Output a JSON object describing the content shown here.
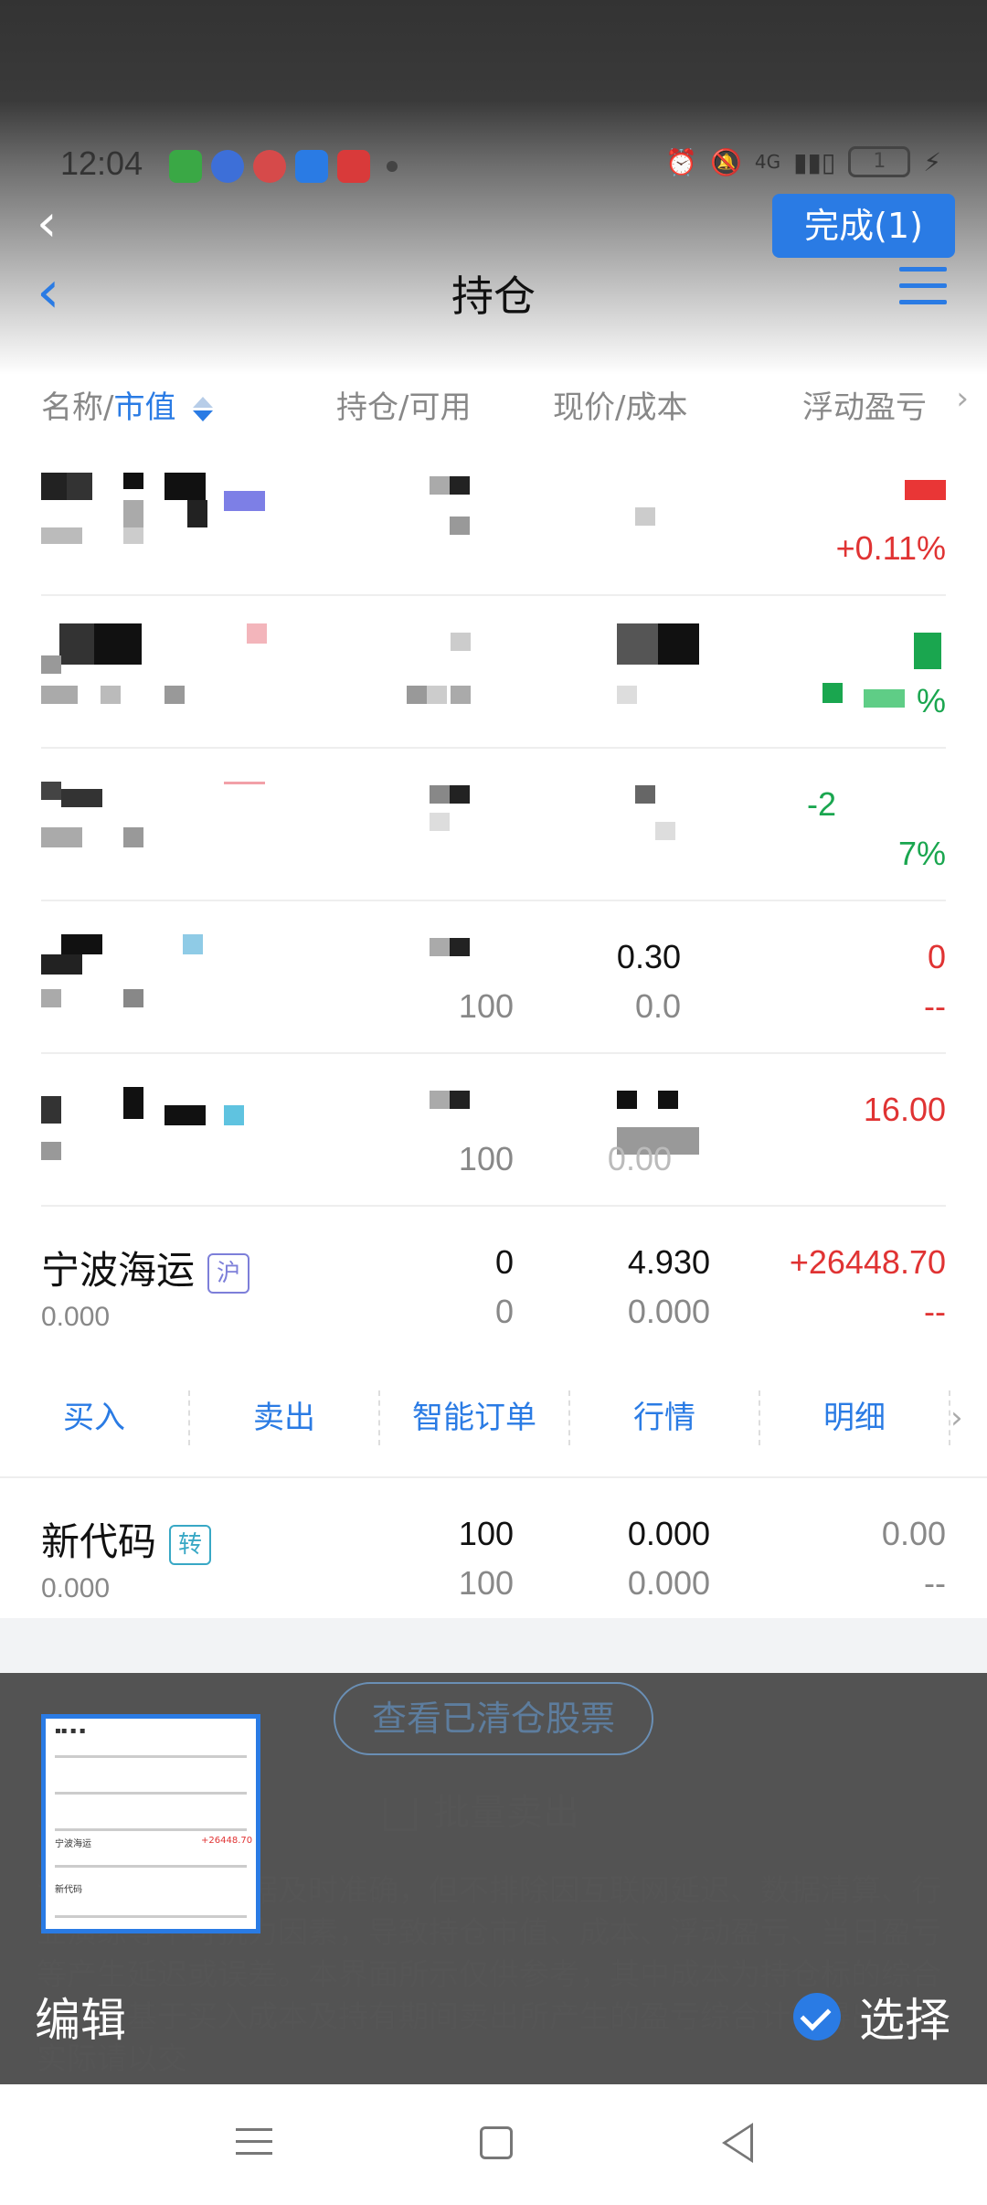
{
  "status_bar": {
    "time": "12:04",
    "network": "4G",
    "battery": "1"
  },
  "editor": {
    "done_button": "完成(1)",
    "edit_label": "编辑",
    "select_label": "选择"
  },
  "nav": {
    "title": "持仓"
  },
  "columns": {
    "name_prefix": "名称/",
    "name_sort": "市值",
    "holdings": "持仓/可用",
    "price": "现价/成本",
    "pnl": "浮动盈亏"
  },
  "rows": [
    {
      "name": "",
      "sub": "",
      "hold": "",
      "avail": "",
      "price": "",
      "cost": "",
      "pnl": "",
      "pnl_pct": "+0.11%"
    },
    {
      "name": "",
      "sub": "",
      "hold": "",
      "avail": "",
      "price": "",
      "cost": "",
      "pnl": "",
      "pnl_pct": "%"
    },
    {
      "name": "",
      "sub": "",
      "hold": "",
      "avail": "",
      "price": "",
      "cost": "",
      "pnl": "-2",
      "pnl_pct": "7%"
    },
    {
      "name": "",
      "sub": "",
      "hold": "",
      "avail": "100",
      "price": "0.30",
      "cost": "0.0",
      "pnl": "0",
      "pnl_pct": "--"
    },
    {
      "name": "",
      "sub": "",
      "hold": "",
      "avail": "100",
      "price": "",
      "cost": "0.00",
      "pnl": "16.00",
      "pnl_pct": ""
    }
  ],
  "stock_ningbo": {
    "name": "宁波海运",
    "tag": "沪",
    "sub": "0.000",
    "hold": "0",
    "avail": "0",
    "price": "4.930",
    "cost": "0.000",
    "pnl": "+26448.70",
    "pnl_pct": "--"
  },
  "actions": [
    "买入",
    "卖出",
    "智能订单",
    "行情",
    "明细"
  ],
  "stock_new": {
    "name": "新代码",
    "tag": "转",
    "sub": "0.000",
    "hold": "100",
    "avail": "100",
    "price": "0.000",
    "cost": "0.000",
    "pnl": "0.00",
    "pnl_pct": "--"
  },
  "bottom": {
    "view_cleared": "查看已清仓股票",
    "batch_sell": "批量卖出",
    "disclaimer": "海通证券力求数据及时准确，但不排除因互联网延迟、数据清算、行业演练等不可抗力因素，导致持仓市值、成本、浮动盈亏、当日盈亏等产生延迟或误差。本界面所示仅供参考，其中成本为持仓标的综合成本（基于买入成本及持有期间卖出所产生的盈亏综合计算得出），实际请以交"
  },
  "colors": {
    "accent": "#2a7be4",
    "up": "#e03333",
    "down": "#1aa64f"
  }
}
